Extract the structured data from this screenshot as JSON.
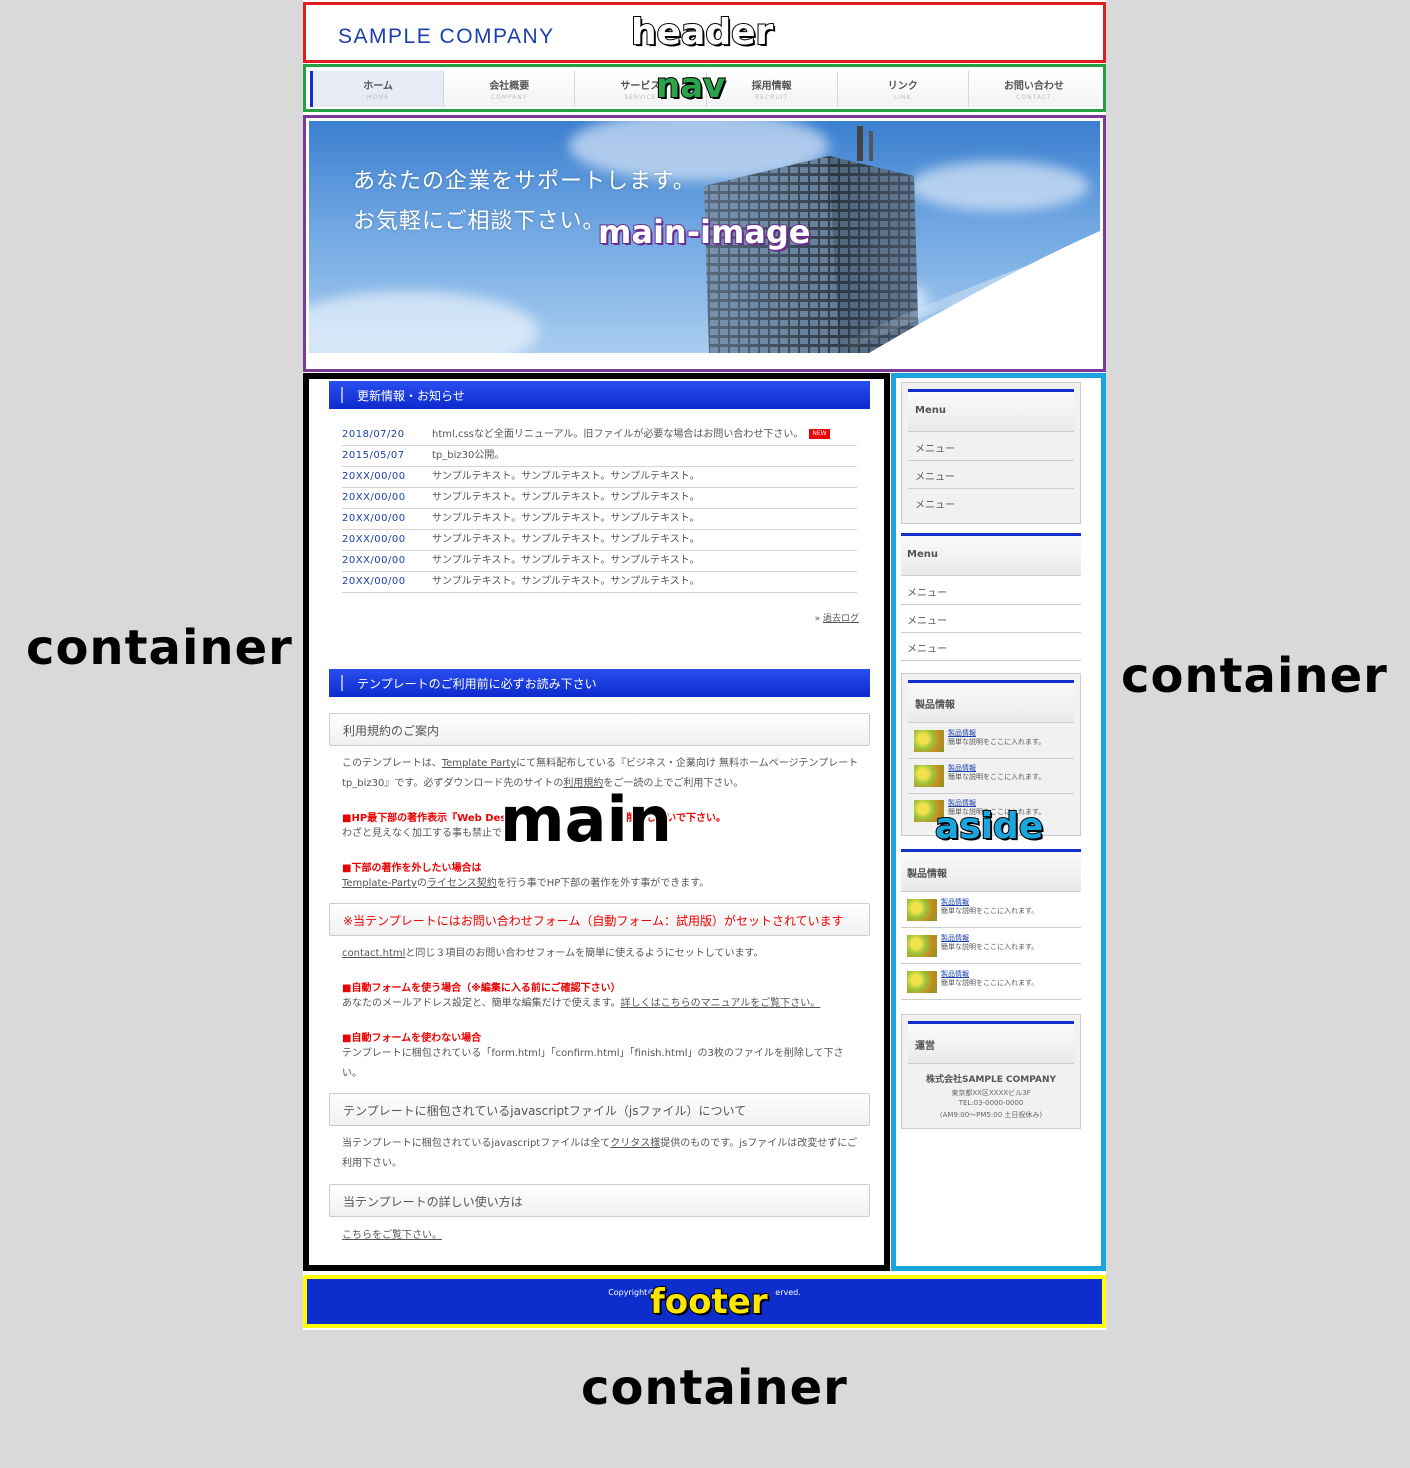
{
  "header": {
    "logo": "SAMPLE COMPANY",
    "label": "header"
  },
  "nav": {
    "label": "nav",
    "items": [
      {
        "jp": "ホーム",
        "en": "HOME"
      },
      {
        "jp": "会社概要",
        "en": "COMPANY"
      },
      {
        "jp": "サービス",
        "en": "SERVICE"
      },
      {
        "jp": "採用情報",
        "en": "RECRUIT"
      },
      {
        "jp": "リンク",
        "en": "LINK"
      },
      {
        "jp": "お問い合わせ",
        "en": "CONTACT"
      }
    ]
  },
  "main_image": {
    "label": "main-image",
    "line1": "あなたの企業をサポートします。",
    "line2": "お気軽にご相談下さい。"
  },
  "main": {
    "label": "main",
    "news_title": "更新情報・お知らせ",
    "news": [
      {
        "date": "2018/07/20",
        "text": "html,cssなど全面リニューアル。旧ファイルが必要な場合はお問い合わせ下さい。",
        "badge": "NEW"
      },
      {
        "date": "2015/05/07",
        "text": "tp_biz30公開。"
      },
      {
        "date": "20XX/00/00",
        "text": "サンプルテキスト。サンプルテキスト。サンプルテキスト。"
      },
      {
        "date": "20XX/00/00",
        "text": "サンプルテキスト。サンプルテキスト。サンプルテキスト。"
      },
      {
        "date": "20XX/00/00",
        "text": "サンプルテキスト。サンプルテキスト。サンプルテキスト。"
      },
      {
        "date": "20XX/00/00",
        "text": "サンプルテキスト。サンプルテキスト。サンプルテキスト。"
      },
      {
        "date": "20XX/00/00",
        "text": "サンプルテキスト。サンプルテキスト。サンプルテキスト。"
      },
      {
        "date": "20XX/00/00",
        "text": "サンプルテキスト。サンプルテキスト。サンプルテキスト。"
      }
    ],
    "past_log_prefix": "» ",
    "past_log": "過去ログ",
    "template_title": "テンプレートのご利用前に必ずお読み下さい",
    "h3_terms": "利用規約のご案内",
    "terms_text_1": "このテンプレートは、",
    "terms_link_1": "Template Party",
    "terms_text_2": "にて無料配布している『ビジネス・企業向け 無料ホームページテンプレート tp_biz30』です。必ずダウンロード先のサイトの",
    "terms_link_2": "利用規約",
    "terms_text_3": "をご一読の上でご利用下さい。",
    "red1": "■HP最下部の著作表示『Web Des",
    "red1_tail": "削除しないで下さい。",
    "hidden_text": "わざと見えなく加工する事も禁止で",
    "red2": "■下部の著作を外したい場合は",
    "license_link_1": "Template-Party",
    "license_text_1": "の",
    "license_link_2": "ライセンス契約",
    "license_text_2": "を行う事でHP下部の著作を外す事ができます。",
    "h3_form": "※当テンプレートにはお問い合わせフォーム（自動フォーム：試用版）がセットされています",
    "form_link": "contact.html",
    "form_text": "と同じ３項目のお問い合わせフォームを簡単に使えるようにセットしています。",
    "red3": "■自動フォームを使う場合（※編集に入る前にご確認下さい）",
    "auto_text": "あなたのメールアドレス設定と、簡単な編集だけで使えます。",
    "auto_link": "詳しくはこちらのマニュアルをご覧下さい。",
    "red4": "■自動フォームを使わない場合",
    "noauto_text": "テンプレートに梱包されている「form.html」「confirm.html」「finish.html」の3枚のファイルを削除して下さい。",
    "h3_js": "テンプレートに梱包されているjavascriptファイル（jsファイル）について",
    "js_text_1": "当テンプレートに梱包されているjavascriptファイルは全て",
    "js_link": "クリタス様",
    "js_text_2": "提供のものです。jsファイルは改変せずにご利用下さい。",
    "h3_usage": "当テンプレートの詳しい使い方は",
    "usage_link": "こちらをご覧下さい。"
  },
  "aside": {
    "label": "aside",
    "menu1": {
      "title": "Menu",
      "items": [
        "メニュー",
        "メニュー",
        "メニュー"
      ]
    },
    "menu2": {
      "title": "Menu",
      "items": [
        "メニュー",
        "メニュー",
        "メニュー"
      ]
    },
    "prod1": {
      "title": "製品情報",
      "items": [
        {
          "name": "製品情報",
          "desc": "簡単な説明をここに入れます。"
        },
        {
          "name": "製品情報",
          "desc": "簡単な説明をここに入れます。"
        },
        {
          "name": "製品情報",
          "desc": "簡単な説明をここに入れます。"
        }
      ]
    },
    "prod2": {
      "title": "製品情報",
      "items": [
        {
          "name": "製品情報",
          "desc": "簡単な説明をここに入れます。"
        },
        {
          "name": "製品情報",
          "desc": "簡単な説明をここに入れます。"
        },
        {
          "name": "製品情報",
          "desc": "簡単な説明をここに入れます。"
        }
      ]
    },
    "company": {
      "title": "運営",
      "name": "株式会社SAMPLE COMPANY",
      "address": "東京都XX区XXXXビル3F",
      "tel": "TEL:03-0000-0000",
      "hours": "(AM9:00～PM5:00 土日祝休み)"
    }
  },
  "footer": {
    "label": "footer",
    "copy_left": "Copyright©",
    "copy_right": "erved.",
    "line2": "("
  },
  "container_labels": [
    "container",
    "container",
    "container"
  ]
}
